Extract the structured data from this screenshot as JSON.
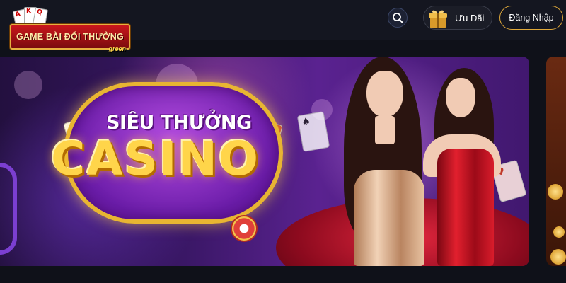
{
  "header": {
    "logo": {
      "text": "GAME BÀI ĐỔI THƯỞNG",
      "sub": "green",
      "cards": [
        "A",
        "K",
        "Q"
      ]
    },
    "search": {
      "icon": "search-icon"
    },
    "promo": {
      "label": "Ưu Đãi",
      "icon": "gift-icon"
    },
    "login": {
      "label": "Đăng Nhập"
    }
  },
  "banner": {
    "title_line1": "SIÊU THƯỞNG",
    "title_line2": "CASINO",
    "cards": [
      "A",
      "K",
      "♠",
      "♥",
      "♠",
      "♥"
    ]
  },
  "colors": {
    "accent_gold": "#e0a93a",
    "header_bg": "#141620",
    "page_bg": "#0f1119"
  }
}
